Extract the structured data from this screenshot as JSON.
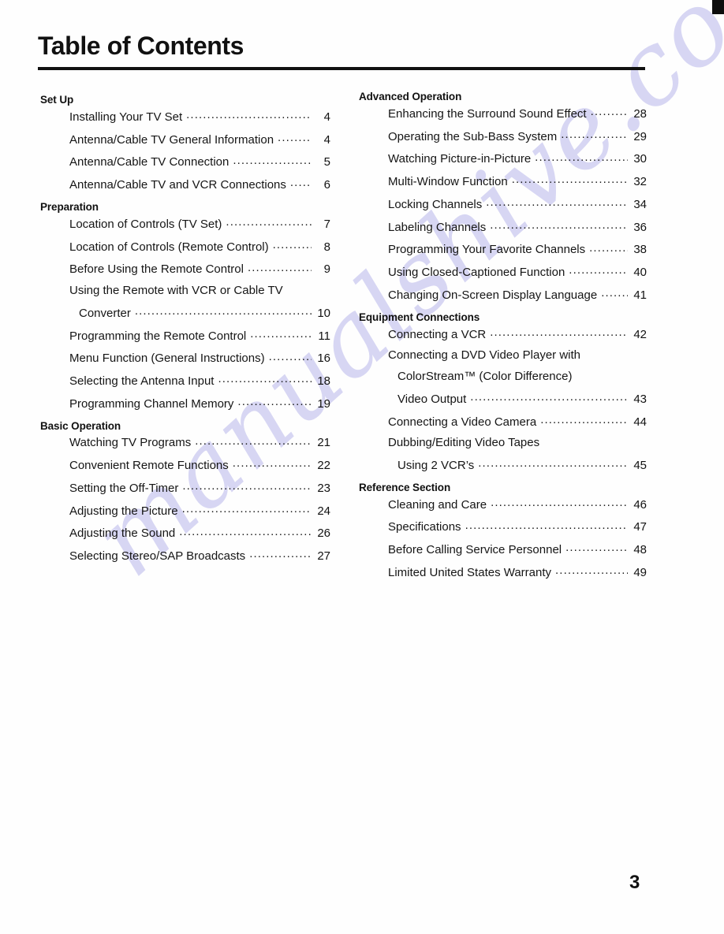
{
  "document": {
    "title": "Table of Contents",
    "page_number": "3",
    "watermark_text": "manualshive.com",
    "watermark_color": "#c9c8ef",
    "rule_color": "#111111"
  },
  "columns": {
    "left": [
      {
        "section": "Set Up",
        "entries": [
          {
            "label": "Installing Your TV Set",
            "page": "4",
            "indent": "normal"
          },
          {
            "label": "Antenna/Cable TV General Information",
            "page": "4",
            "indent": "normal"
          },
          {
            "label": "Antenna/Cable TV Connection",
            "page": "5",
            "indent": "normal"
          },
          {
            "label": "Antenna/Cable TV and VCR Connections",
            "page": "6",
            "indent": "normal"
          }
        ]
      },
      {
        "section": "Preparation",
        "entries": [
          {
            "label": "Location of Controls (TV Set)",
            "page": "7",
            "indent": "normal"
          },
          {
            "label": "Location of Controls (Remote Control)",
            "page": "8",
            "indent": "normal"
          },
          {
            "label": "Before Using the Remote Control",
            "page": "9",
            "indent": "normal"
          },
          {
            "label": "Using the Remote with VCR or Cable TV",
            "page": "",
            "indent": "normal",
            "leader": false
          },
          {
            "label": "Converter",
            "page": "10",
            "indent": "sub"
          },
          {
            "label": "Programming the Remote Control",
            "page": "11",
            "indent": "normal"
          },
          {
            "label": "Menu Function (General Instructions)",
            "page": "16",
            "indent": "normal"
          },
          {
            "label": "Selecting the Antenna Input",
            "page": "18",
            "indent": "normal"
          },
          {
            "label": "Programming Channel Memory",
            "page": "19",
            "indent": "normal"
          }
        ]
      },
      {
        "section": "Basic Operation",
        "entries": [
          {
            "label": "Watching TV Programs",
            "page": "21",
            "indent": "normal"
          },
          {
            "label": "Convenient Remote Functions",
            "page": "22",
            "indent": "normal"
          },
          {
            "label": "Setting the Off-Timer",
            "page": "23",
            "indent": "normal"
          },
          {
            "label": "Adjusting the Picture",
            "page": "24",
            "indent": "normal"
          },
          {
            "label": "Adjusting the Sound",
            "page": "26",
            "indent": "normal"
          },
          {
            "label": "Selecting Stereo/SAP Broadcasts",
            "page": "27",
            "indent": "normal"
          }
        ]
      }
    ],
    "right": [
      {
        "section": "Advanced Operation",
        "entries": [
          {
            "label": "Enhancing the Surround Sound Effect",
            "page": "28",
            "indent": "normal"
          },
          {
            "label": "Operating the Sub-Bass System",
            "page": "29",
            "indent": "normal"
          },
          {
            "label": "Watching Picture-in-Picture",
            "page": "30",
            "indent": "normal"
          },
          {
            "label": "Multi-Window Function",
            "page": "32",
            "indent": "normal"
          },
          {
            "label": "Locking Channels",
            "page": "34",
            "indent": "normal"
          },
          {
            "label": "Labeling Channels",
            "page": "36",
            "indent": "normal"
          },
          {
            "label": "Programming Your Favorite Channels",
            "page": "38",
            "indent": "normal"
          },
          {
            "label": "Using Closed-Captioned Function",
            "page": "40",
            "indent": "normal"
          },
          {
            "label": "Changing On-Screen Display Language",
            "page": "41",
            "indent": "normal"
          }
        ]
      },
      {
        "section": "Equipment Connections",
        "entries": [
          {
            "label": "Connecting a VCR",
            "page": "42",
            "indent": "normal"
          },
          {
            "label": "Connecting a DVD Video Player with",
            "page": "",
            "indent": "normal",
            "leader": false
          },
          {
            "label": "ColorStream™ (Color Difference)",
            "page": "",
            "indent": "sub",
            "leader": false
          },
          {
            "label": "Video Output",
            "page": "43",
            "indent": "sub"
          },
          {
            "label": "Connecting a Video Camera",
            "page": "44",
            "indent": "normal"
          },
          {
            "label": "Dubbing/Editing Video Tapes",
            "page": "",
            "indent": "normal",
            "leader": false
          },
          {
            "label": "Using 2 VCR’s",
            "page": "45",
            "indent": "sub"
          }
        ]
      },
      {
        "section": "Reference Section",
        "entries": [
          {
            "label": "Cleaning and Care",
            "page": "46",
            "indent": "normal"
          },
          {
            "label": "Specifications",
            "page": "47",
            "indent": "normal"
          },
          {
            "label": "Before Calling Service Personnel",
            "page": "48",
            "indent": "normal"
          },
          {
            "label": "Limited United States Warranty",
            "page": "49",
            "indent": "normal"
          }
        ]
      }
    ]
  }
}
